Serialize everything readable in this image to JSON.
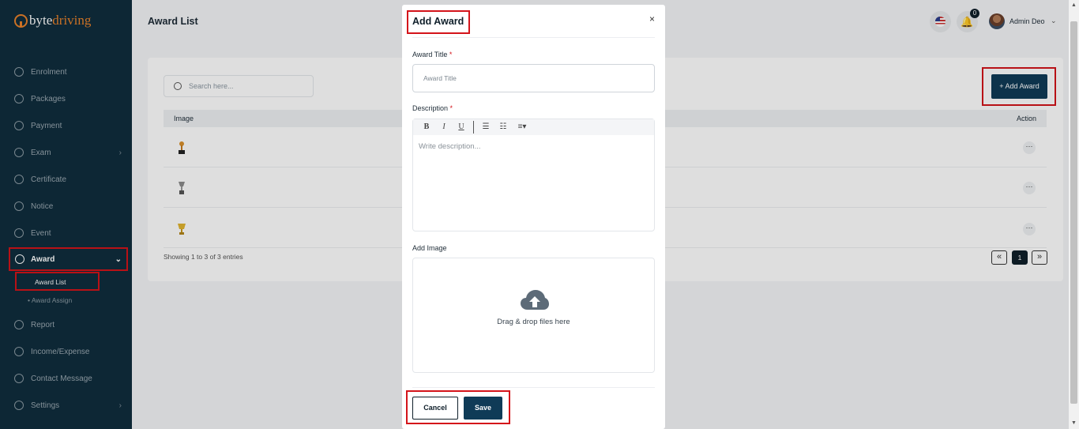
{
  "brand": {
    "logo_part1": "byte",
    "logo_part2": "driving"
  },
  "sidebar": {
    "items": [
      {
        "label": "Enrolment",
        "icon": "enrolment-icon"
      },
      {
        "label": "Packages",
        "icon": "packages-icon"
      },
      {
        "label": "Payment",
        "icon": "payment-icon"
      },
      {
        "label": "Exam",
        "icon": "exam-icon",
        "has_children": true
      },
      {
        "label": "Certificate",
        "icon": "certificate-icon"
      },
      {
        "label": "Notice",
        "icon": "notice-icon"
      },
      {
        "label": "Event",
        "icon": "event-icon"
      },
      {
        "label": "Award",
        "icon": "award-icon",
        "expanded": true
      },
      {
        "label": "Report",
        "icon": "report-icon"
      },
      {
        "label": "Income/Expense",
        "icon": "income-expense-icon"
      },
      {
        "label": "Contact Message",
        "icon": "contact-message-icon"
      },
      {
        "label": "Settings",
        "icon": "settings-icon",
        "has_children": true
      }
    ],
    "award_sub": {
      "award_list": "Award List",
      "award_assign": "Award Assign"
    }
  },
  "header": {
    "title": "Award List",
    "notification_count": "0",
    "user_name": "Admin Deo"
  },
  "content": {
    "search_placeholder": "Search here...",
    "add_button": "+ Add Award",
    "table": {
      "columns": [
        "Image",
        "Action"
      ],
      "rows": [
        {
          "action": "···"
        },
        {
          "action": "···"
        },
        {
          "action": "···"
        }
      ]
    },
    "entries_text": "Showing 1 to 3 of 3 entries",
    "pagination": {
      "prev": "«",
      "current": "1",
      "next": "»"
    }
  },
  "modal": {
    "title": "Add Award",
    "close": "×",
    "award_title_label": "Award Title",
    "award_title_placeholder": "Award Title",
    "required_mark": "*",
    "description_label": "Description",
    "editor_toolbar": {
      "bold": "B",
      "italic": "I",
      "underline": "U",
      "ul": "☰",
      "ol": "☷",
      "align": "≡▾"
    },
    "description_placeholder": "Write description...",
    "add_image_label": "Add Image",
    "dropzone_text": "Drag & drop files here",
    "cancel_label": "Cancel",
    "save_label": "Save"
  },
  "colors": {
    "sidebar_bg": "#0f2d3d",
    "primary": "#0f3b57",
    "highlight": "#d4141a",
    "accent": "#e8822b"
  }
}
